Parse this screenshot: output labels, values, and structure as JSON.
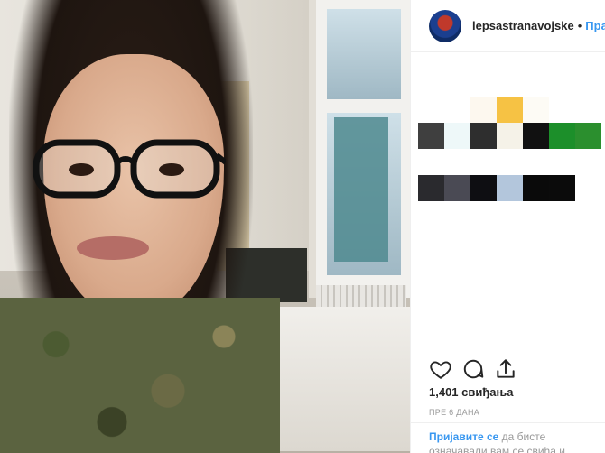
{
  "post": {
    "username": "lepsastranavojske",
    "separator": "•",
    "follow_label": "Прати",
    "likes_text": "1,401 свиђања",
    "time_text": "ПРЕ 6 ДАНА",
    "login_link": "Пријавите се",
    "login_rest": " да бисте означавали вам се свиђа и коментарисали"
  },
  "caption_mosaic": [
    [
      "#ffffff",
      "#ffffff",
      "#ffffff",
      "#ffffff",
      "#ffffff",
      "#ffffff",
      "#ffffff"
    ],
    [
      "#ffffff",
      "#ffffff",
      "#fdf8ef",
      "#f6c244",
      "#fdfbf5",
      "#ffffff",
      "#ffffff"
    ],
    [
      "#3f3f3f",
      "#eef8f9",
      "#2e2e2e",
      "#f5f2e8",
      "#111111",
      "#1c8f2a",
      "#2b8f2e"
    ],
    [
      "#ffffff",
      "#ffffff",
      "#ffffff",
      "#ffffff",
      "#ffffff",
      "#ffffff",
      "#ffffff"
    ],
    [
      "#2a2a2e",
      "#4a4a54",
      "#0e0e12",
      "#b3c6dc",
      "#0a0a0a",
      "#0b0b0b",
      "#ffffff"
    ]
  ],
  "colors": {
    "accent": "#3897f0",
    "text": "#262626",
    "muted": "#999999"
  },
  "icons": [
    "heart-icon",
    "comment-icon",
    "share-icon"
  ]
}
